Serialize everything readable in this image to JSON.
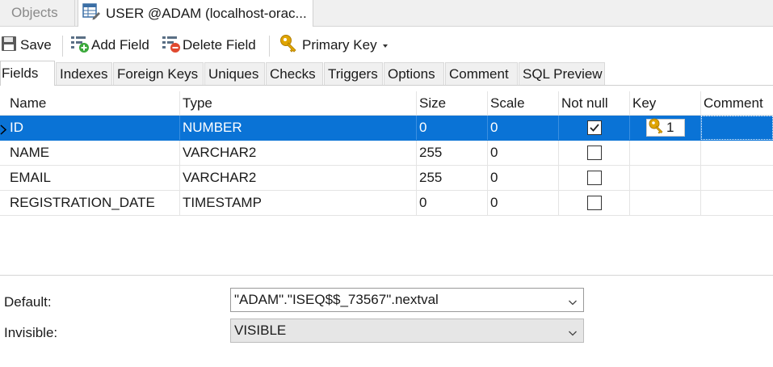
{
  "doc_tabs": {
    "objects_label": "Objects",
    "active_label": "USER @ADAM (localhost-orac..."
  },
  "toolbar": {
    "save_label": "Save",
    "add_field_label": "Add Field",
    "delete_field_label": "Delete Field",
    "primary_key_label": "Primary Key"
  },
  "subtabs": [
    {
      "label": "Fields"
    },
    {
      "label": "Indexes"
    },
    {
      "label": "Foreign Keys"
    },
    {
      "label": "Uniques"
    },
    {
      "label": "Checks"
    },
    {
      "label": "Triggers"
    },
    {
      "label": "Options"
    },
    {
      "label": "Comment"
    },
    {
      "label": "SQL Preview"
    }
  ],
  "grid": {
    "columns": {
      "name": "Name",
      "type": "Type",
      "size": "Size",
      "scale": "Scale",
      "not_null": "Not null",
      "key": "Key",
      "comment": "Comment"
    },
    "rows": [
      {
        "name": "ID",
        "type": "NUMBER",
        "size": "0",
        "scale": "0",
        "not_null": true,
        "key": "1",
        "comment": ""
      },
      {
        "name": "NAME",
        "type": "VARCHAR2",
        "size": "255",
        "scale": "0",
        "not_null": false,
        "key": "",
        "comment": ""
      },
      {
        "name": "EMAIL",
        "type": "VARCHAR2",
        "size": "255",
        "scale": "0",
        "not_null": false,
        "key": "",
        "comment": ""
      },
      {
        "name": "REGISTRATION_DATE",
        "type": "TIMESTAMP",
        "size": "0",
        "scale": "0",
        "not_null": false,
        "key": "",
        "comment": ""
      }
    ]
  },
  "properties": {
    "default_label": "Default:",
    "default_value": "\"ADAM\".\"ISEQ$$_73567\".nextval",
    "invisible_label": "Invisible:",
    "invisible_value": "VISIBLE"
  },
  "colors": {
    "selection": "#0a73d6",
    "key_icon": "#e0a500"
  }
}
